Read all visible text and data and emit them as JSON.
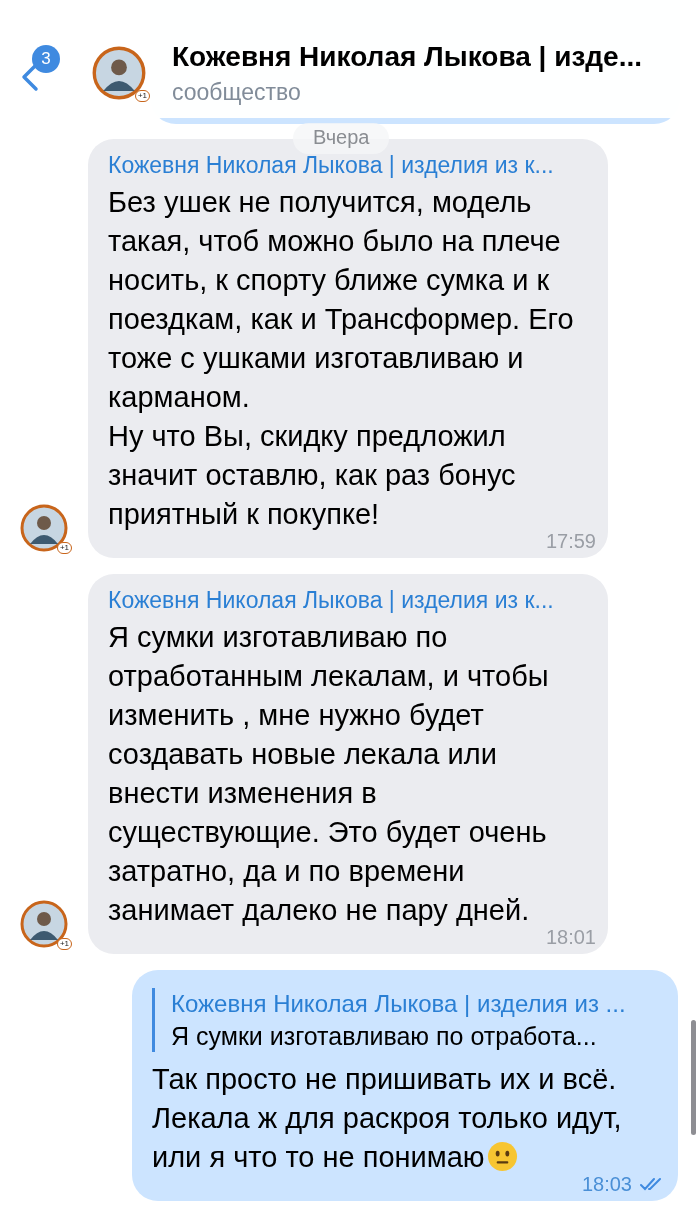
{
  "header": {
    "back_badge": "3",
    "title": "Кожевня Николая Лыкова | изде...",
    "subtitle": "сообщество",
    "avatar_badge": "+1"
  },
  "date_pill": "Вчера",
  "messages": [
    {
      "kind": "incoming",
      "sender": "Кожевня Николая Лыкова | изделия из к...",
      "avatar_badge": "+1",
      "text": "Без ушек не получится, модель такая, чтоб можно было на плече носить, к спорту ближе сумка и к поездкам, как и Трансформер. Его тоже с ушками изготавливаю и карманом.\nНу что Вы, скидку предложил значит оставлю, как раз бонус приятный к покупке!",
      "time": "17:59"
    },
    {
      "kind": "incoming",
      "sender": "Кожевня Николая Лыкова | изделия из к...",
      "avatar_badge": "+1",
      "text": "Я сумки изготавливаю по отработанным лекалам,  и чтобы изменить ,  мне нужно будет создавать новые лекала или внести изменения в существующие. Это будет очень затратно, да и по времени занимает далеко не пару дней.",
      "time": "18:01"
    },
    {
      "kind": "outgoing",
      "reply": {
        "sender": "Кожевня Николая Лыкова | изделия из ...",
        "text": "Я сумки изготавливаю по отработа..."
      },
      "text": "Так просто не пришивать их и всё. Лекала ж для раскроя только идут, или я что то не понимаю",
      "emoji": true,
      "time": "18:03",
      "read": true
    }
  ]
}
